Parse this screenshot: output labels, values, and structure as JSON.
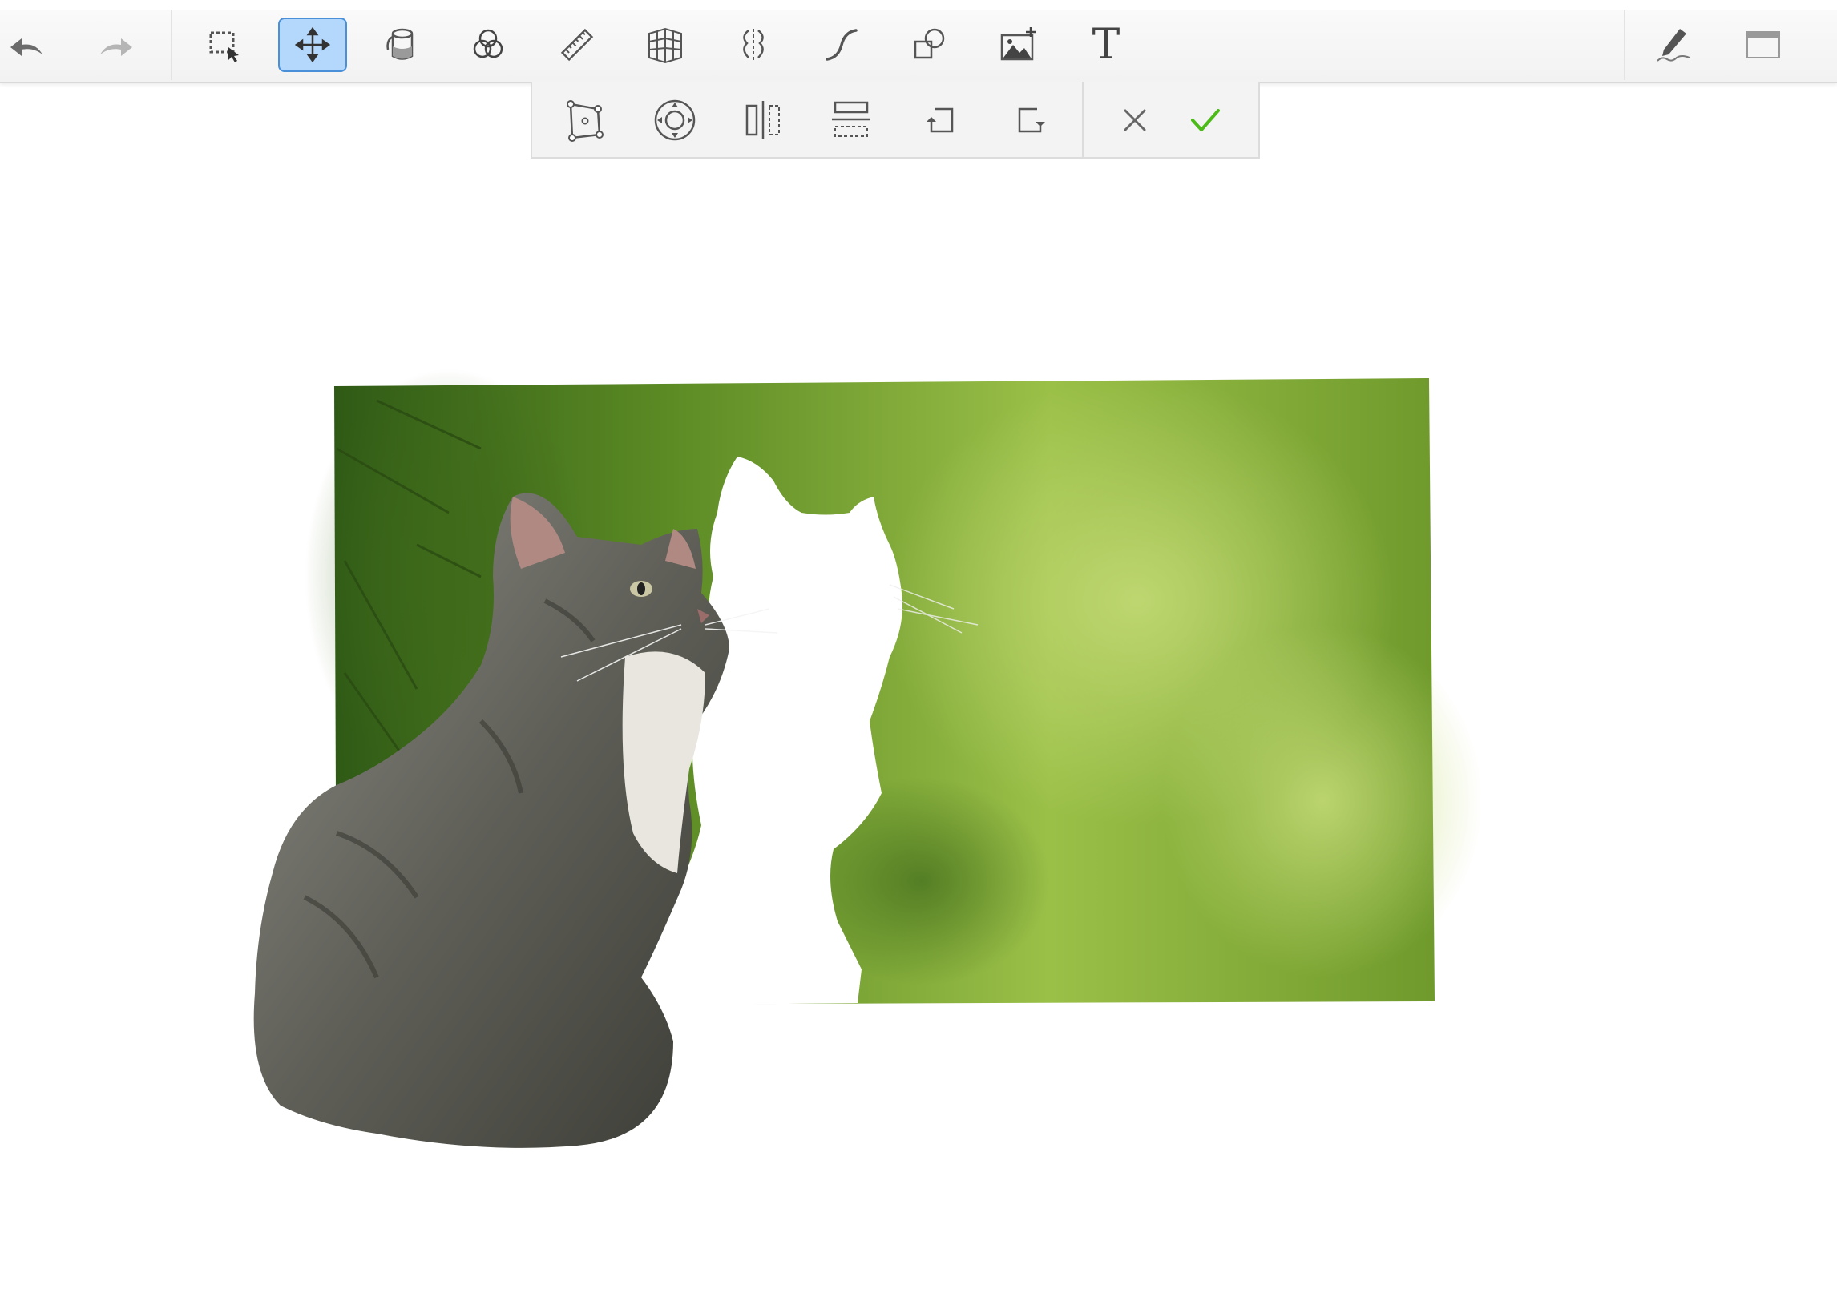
{
  "toolbar": {
    "items": [
      {
        "id": "undo",
        "icon": "undo-icon",
        "interactable": true
      },
      {
        "id": "redo",
        "icon": "redo-icon",
        "interactable": true
      },
      {
        "id": "select",
        "icon": "selection-icon",
        "interactable": true
      },
      {
        "id": "move",
        "icon": "move-icon",
        "interactable": true,
        "active": true
      },
      {
        "id": "fill",
        "icon": "paint-bucket-icon",
        "interactable": true
      },
      {
        "id": "blend",
        "icon": "blend-circles-icon",
        "interactable": true
      },
      {
        "id": "ruler",
        "icon": "ruler-icon",
        "interactable": true
      },
      {
        "id": "perspective",
        "icon": "perspective-grid-icon",
        "interactable": true
      },
      {
        "id": "symmetry",
        "icon": "symmetry-icon",
        "interactable": true
      },
      {
        "id": "curve",
        "icon": "curve-icon",
        "interactable": true
      },
      {
        "id": "shapes",
        "icon": "shapes-icon",
        "interactable": true
      },
      {
        "id": "add-image",
        "icon": "add-image-icon",
        "interactable": true
      },
      {
        "id": "text",
        "icon": "text-icon",
        "interactable": true
      },
      {
        "id": "pen",
        "icon": "pen-signature-icon",
        "interactable": true
      },
      {
        "id": "window",
        "icon": "window-icon",
        "interactable": true
      }
    ],
    "text_tool_label": "T",
    "active_color": "#b4d8fb"
  },
  "transform_bar": {
    "items": [
      {
        "id": "free-transform",
        "icon": "free-transform-icon"
      },
      {
        "id": "rotate",
        "icon": "rotate-dial-icon"
      },
      {
        "id": "flip-horizontal",
        "icon": "flip-horizontal-icon"
      },
      {
        "id": "flip-vertical",
        "icon": "flip-vertical-icon"
      },
      {
        "id": "rotate-left",
        "icon": "rotate-left-icon"
      },
      {
        "id": "rotate-right",
        "icon": "rotate-right-icon"
      },
      {
        "id": "cancel",
        "icon": "close-icon"
      },
      {
        "id": "confirm",
        "icon": "checkmark-icon"
      }
    ],
    "confirm_color": "#4cbb17"
  },
  "canvas": {
    "image_description_icon": "kitten-photo",
    "background_color": "#ffffff",
    "photo_colors": [
      "#6f9a2c",
      "#9bc048",
      "#3f6a1a"
    ]
  }
}
